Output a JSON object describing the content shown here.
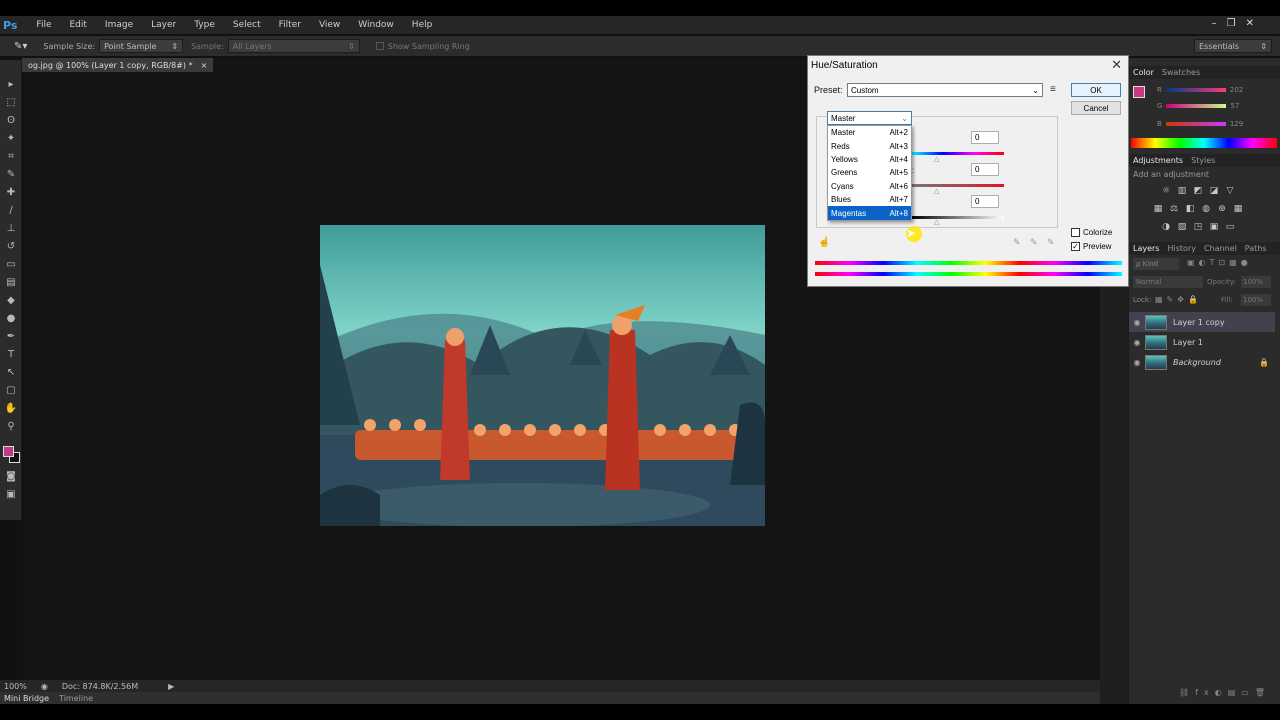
{
  "app": {
    "logo": "Ps"
  },
  "menu": [
    "File",
    "Edit",
    "Image",
    "Layer",
    "Type",
    "Select",
    "Filter",
    "View",
    "Window",
    "Help"
  ],
  "window_controls": [
    "–",
    "❐",
    "✕"
  ],
  "options_bar": {
    "sample_size_label": "Sample Size:",
    "sample_size_value": "Point Sample",
    "sample_label": "Sample:",
    "sample_value": "All Layers",
    "show_ring_label": "Show Sampling Ring",
    "workspace": "Essentials"
  },
  "document": {
    "tab_title": "og.jpg @ 100% (Layer 1 copy, RGB/8#) *",
    "close": "×"
  },
  "status": {
    "zoom": "100%",
    "doc_info": "Doc: 874.8K/2.56M",
    "mini_bridge": "Mini Bridge",
    "timeline": "Timeline"
  },
  "dialog": {
    "title": "Hue/Saturation",
    "close": "✕",
    "preset_label": "Preset:",
    "preset_value": "Custom",
    "ok": "OK",
    "cancel": "Cancel",
    "channel_value": "Master",
    "hue_value": "0",
    "saturation_value": "0",
    "lightness_value": "0",
    "colorize_label": "Colorize",
    "preview_label": "Preview",
    "colorize_checked": false,
    "preview_checked": true,
    "channel_options": [
      {
        "label": "Master",
        "shortcut": "Alt+2"
      },
      {
        "label": "Reds",
        "shortcut": "Alt+3"
      },
      {
        "label": "Yellows",
        "shortcut": "Alt+4"
      },
      {
        "label": "Greens",
        "shortcut": "Alt+5"
      },
      {
        "label": "Cyans",
        "shortcut": "Alt+6"
      },
      {
        "label": "Blues",
        "shortcut": "Alt+7"
      },
      {
        "label": "Magentas",
        "shortcut": "Alt+8"
      }
    ],
    "highlighted_option": "Magentas",
    "obscured_label_fragment": ":"
  },
  "color_panel": {
    "tabs": [
      "Color",
      "Swatches"
    ],
    "r_label": "R",
    "g_label": "G",
    "b_label": "B",
    "r": "202",
    "g": "57",
    "b": "129",
    "foreground": "#ca3981"
  },
  "adjustments_panel": {
    "tabs": [
      "Adjustments",
      "Styles"
    ],
    "hint": "Add an adjustment"
  },
  "layers_panel": {
    "tabs": [
      "Layers",
      "History",
      "Channel",
      "Paths"
    ],
    "kind": "ρ Kind",
    "blend_mode": "Normal",
    "opacity_label": "Opacity:",
    "opacity_value": "100%",
    "lock_label": "Lock:",
    "fill_label": "Fill:",
    "fill_value": "100%",
    "layers": [
      {
        "name": "Layer 1 copy",
        "selected": true
      },
      {
        "name": "Layer 1",
        "selected": false
      },
      {
        "name": "Background",
        "selected": false
      }
    ]
  }
}
